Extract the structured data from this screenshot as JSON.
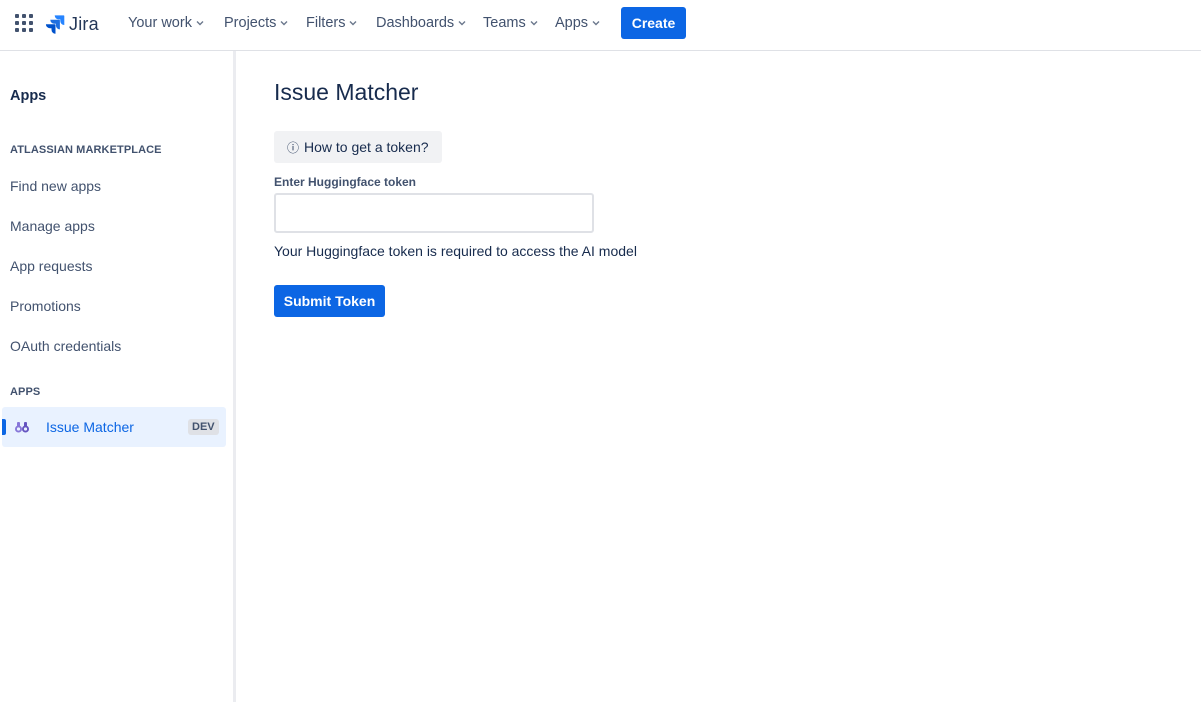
{
  "topnav": {
    "logo_text": "Jira",
    "items": [
      {
        "label": "Your work"
      },
      {
        "label": "Projects"
      },
      {
        "label": "Filters"
      },
      {
        "label": "Dashboards"
      },
      {
        "label": "Teams"
      },
      {
        "label": "Apps"
      }
    ],
    "create_label": "Create"
  },
  "sidebar": {
    "title": "Apps",
    "marketplace_heading": "ATLASSIAN MARKETPLACE",
    "marketplace_items": [
      {
        "label": "Find new apps"
      },
      {
        "label": "Manage apps"
      },
      {
        "label": "App requests"
      },
      {
        "label": "Promotions"
      },
      {
        "label": "OAuth credentials"
      }
    ],
    "apps_heading": "APPS",
    "active_app": {
      "label": "Issue Matcher",
      "badge": "DEV",
      "icon": "binoculars-icon"
    }
  },
  "main": {
    "title": "Issue Matcher",
    "help_button": {
      "icon": "ⓘ",
      "label": "How to get a token?"
    },
    "token_field": {
      "label": "Enter Huggingface token",
      "value": "",
      "placeholder": ""
    },
    "helper_text": "Your Huggingface token is required to access the AI model",
    "submit_label": "Submit Token"
  },
  "colors": {
    "primary": "#0c66e4",
    "text": "#172b4d",
    "subtle_text": "#42526e",
    "selected_bg": "#e9f2ff",
    "neutral_bg": "#f1f2f4"
  }
}
